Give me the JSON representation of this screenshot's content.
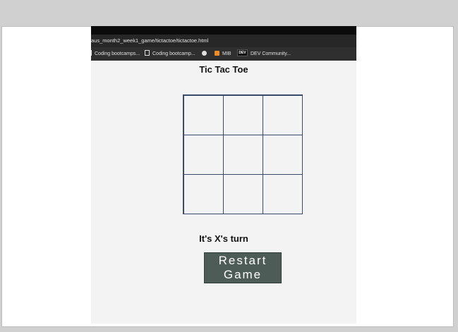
{
  "browser": {
    "address": "aus_month2_week1_game/tictactoe/tictactoe.html",
    "bookmarks": [
      {
        "label": "Coding bootcamps...",
        "icon": "document-icon"
      },
      {
        "label": "Coding bootcamp...",
        "icon": "notion-icon"
      },
      {
        "label": "",
        "icon": "globe-icon"
      },
      {
        "label": "MIB",
        "icon": "orange-bookmark-icon"
      },
      {
        "label": "DEV Community...",
        "icon": "dev-logo-icon",
        "icon_text": "DEV"
      }
    ]
  },
  "game": {
    "title": "Tic Tac Toe",
    "cells": [
      "",
      "",
      "",
      "",
      "",
      "",
      "",
      "",
      ""
    ],
    "status": "It's X's turn",
    "restart_line1": "Restart",
    "restart_line2": "Game"
  },
  "colors": {
    "page_bg": "#f3f3f3",
    "grid_line": "#3a4a6a",
    "button_bg": "#4e5c57",
    "button_text": "#ffffff",
    "viewer_bg": "#d0d0d0"
  }
}
